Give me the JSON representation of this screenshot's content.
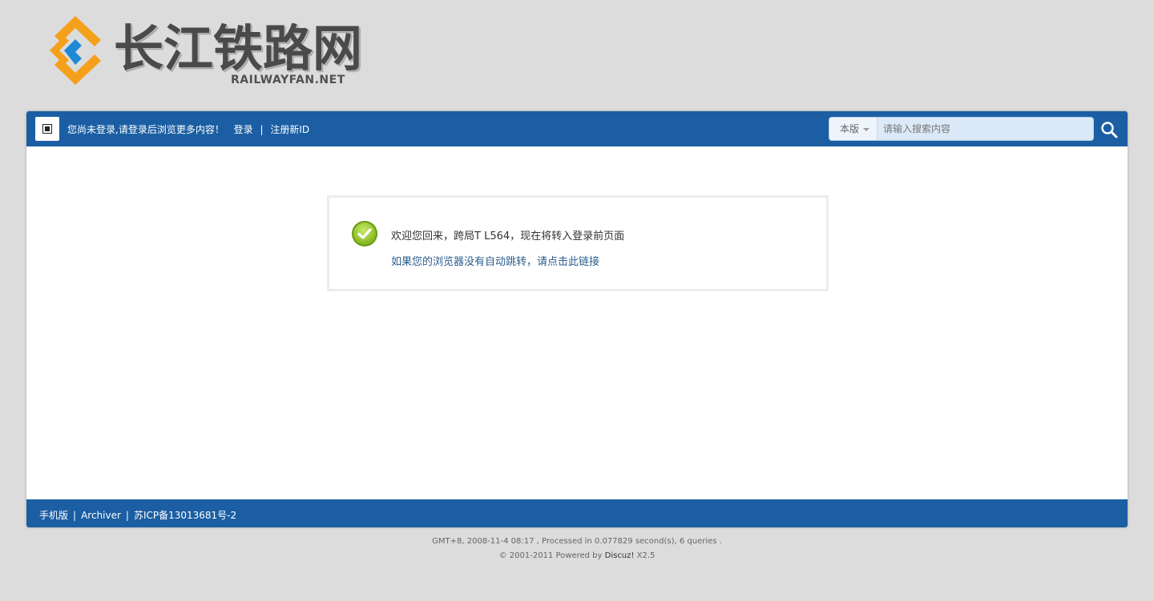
{
  "logo": {
    "cn_text": "长江铁路网",
    "en_text": "RAILWAYFAN.NET"
  },
  "topbar": {
    "login_prompt": "您尚未登录,请登录后浏览更多内容！",
    "login_link": "登录",
    "separator": "|",
    "register_link": "注册新ID",
    "icon": "qrcode-icon"
  },
  "search": {
    "scope_label": "本版",
    "placeholder": "请输入搜索内容",
    "value": "",
    "icon": "search-icon"
  },
  "message": {
    "icon": "check-circle-icon",
    "welcome_text": "欢迎您回来，跨局T L564，现在将转入登录前页面",
    "redirect_link": "如果您的浏览器没有自动跳转，请点击此链接"
  },
  "footer_bar": {
    "mobile_link": "手机版",
    "archiver_link": "Archiver",
    "icp_link": "苏ICP备13013681号-2",
    "separator": "|"
  },
  "footer_info": {
    "stats": "GMT+8, 2008-11-4 08:17 , Processed in 0.077829 second(s), 6 queries .",
    "copyright_prefix": "© 2001-2011 Powered by",
    "brand": "Discuz!",
    "version": "X2.5"
  },
  "colors": {
    "bar_blue": "#1b5ea3",
    "page_bg": "#dcdcdc",
    "link_blue": "#2b5d8c",
    "logo_orange": "#f5a01a",
    "logo_blue": "#1e8ad6"
  }
}
